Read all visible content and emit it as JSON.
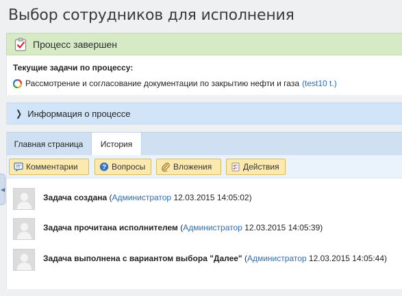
{
  "page": {
    "title": "Выбор сотрудников для исполнения"
  },
  "status": {
    "text": "Процесс завершен",
    "icon": "clipboard-check-icon",
    "color": "#d7eac6"
  },
  "tasks": {
    "heading": "Текущие задачи по процессу:",
    "items": [
      {
        "name": "Рассмотрение и согласование документации по закрытию нефти и газа",
        "user": "(test10 t.)",
        "icon": "progress-ring-icon"
      }
    ]
  },
  "info": {
    "label": "Информация о процессе",
    "icon": "chevron-right-icon"
  },
  "tabs": [
    {
      "label": "Главная страница",
      "active": false
    },
    {
      "label": "История",
      "active": true
    }
  ],
  "toolbar": {
    "comments": "Комментарии",
    "questions": "Вопросы",
    "attachments": "Вложения",
    "actions": "Действия"
  },
  "history": [
    {
      "event": "Задача создана",
      "user": "Администратор",
      "timestamp": "12.03.2015 14:05:02"
    },
    {
      "event": "Задача прочитана исполнителем",
      "user": "Администратор",
      "timestamp": "12.03.2015 14:05:39"
    },
    {
      "event": "Задача выполнена с вариантом выбора \"Далее\"",
      "user": "Администратор",
      "timestamp": "12.03.2015 14:05:44"
    }
  ],
  "colors": {
    "accent_link": "#2c6bb5",
    "button_bg": "#fbe9ad",
    "tabs_bg": "#cfe0f3"
  }
}
